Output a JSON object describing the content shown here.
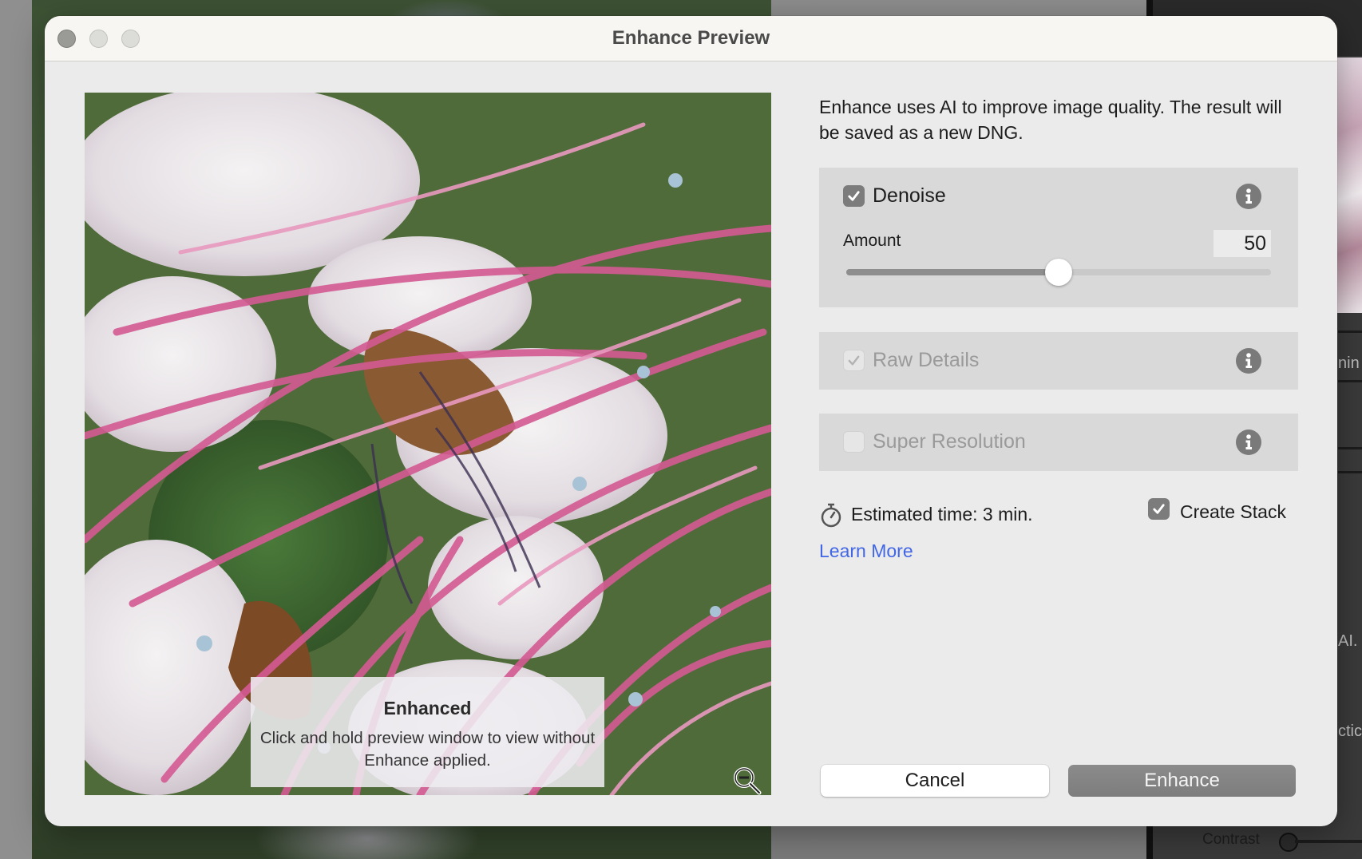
{
  "window": {
    "title": "Enhance Preview",
    "traffic_lights": [
      "close",
      "minimize",
      "zoom"
    ]
  },
  "preview": {
    "overlay_title": "Enhanced",
    "overlay_body": "Click and hold preview window to view without Enhance applied.",
    "zoom_icon": "zoom-out-icon"
  },
  "description": "Enhance uses AI to improve image quality. The result will be saved as a new DNG.",
  "options": {
    "denoise": {
      "label": "Denoise",
      "checked": true,
      "enabled": true,
      "amount_label": "Amount",
      "amount_value": "50",
      "amount_min": 0,
      "amount_max": 100,
      "amount": 50
    },
    "raw_details": {
      "label": "Raw Details",
      "checked": true,
      "enabled": false
    },
    "super_resolution": {
      "label": "Super Resolution",
      "checked": false,
      "enabled": false
    }
  },
  "estimate": {
    "icon": "stopwatch-icon",
    "text": "Estimated time: 3 min."
  },
  "create_stack": {
    "label": "Create Stack",
    "checked": true
  },
  "learn_more": "Learn More",
  "buttons": {
    "cancel": "Cancel",
    "enhance": "Enhance"
  },
  "background_panel": {
    "fragments": [
      "nin",
      "AI. T",
      "ctic"
    ],
    "contrast_label": "Contrast"
  },
  "colors": {
    "link": "#4166e6",
    "checkbox_on": "#7c7c7c",
    "panel": "#d9d9d9",
    "dialog_bg": "#ebebeb"
  }
}
